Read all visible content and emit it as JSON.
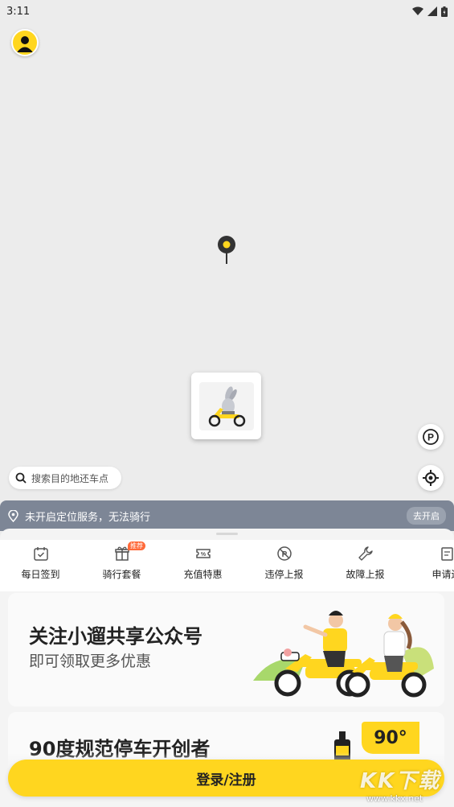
{
  "status_bar": {
    "time": "3:11"
  },
  "map": {
    "parking_label": "P"
  },
  "search": {
    "placeholder": "搜索目的地还车点"
  },
  "location_banner": {
    "text": "未开启定位服务，无法骑行",
    "button": "去开启"
  },
  "menu": {
    "items": [
      {
        "label": "每日签到",
        "icon": "calendar-check-icon"
      },
      {
        "label": "骑行套餐",
        "icon": "gift-icon",
        "badge": "推荐"
      },
      {
        "label": "充值特惠",
        "icon": "percent-ticket-icon"
      },
      {
        "label": "违停上报",
        "icon": "no-parking-icon"
      },
      {
        "label": "故障上报",
        "icon": "wrench-icon"
      },
      {
        "label": "申请还",
        "icon": "document-icon"
      }
    ]
  },
  "promo": {
    "title": "关注小遛共享公众号",
    "subtitle": "即可领取更多优惠"
  },
  "card2": {
    "title": "90度规范停车开创者",
    "badge": "90°"
  },
  "login": {
    "label": "登录/注册"
  },
  "watermark": {
    "logo": "KK下载",
    "url": "www.kkx.net"
  },
  "colors": {
    "brand_yellow": "#ffd61f",
    "banner_gray": "#7d8696",
    "badge_orange": "#ff6a3a"
  }
}
